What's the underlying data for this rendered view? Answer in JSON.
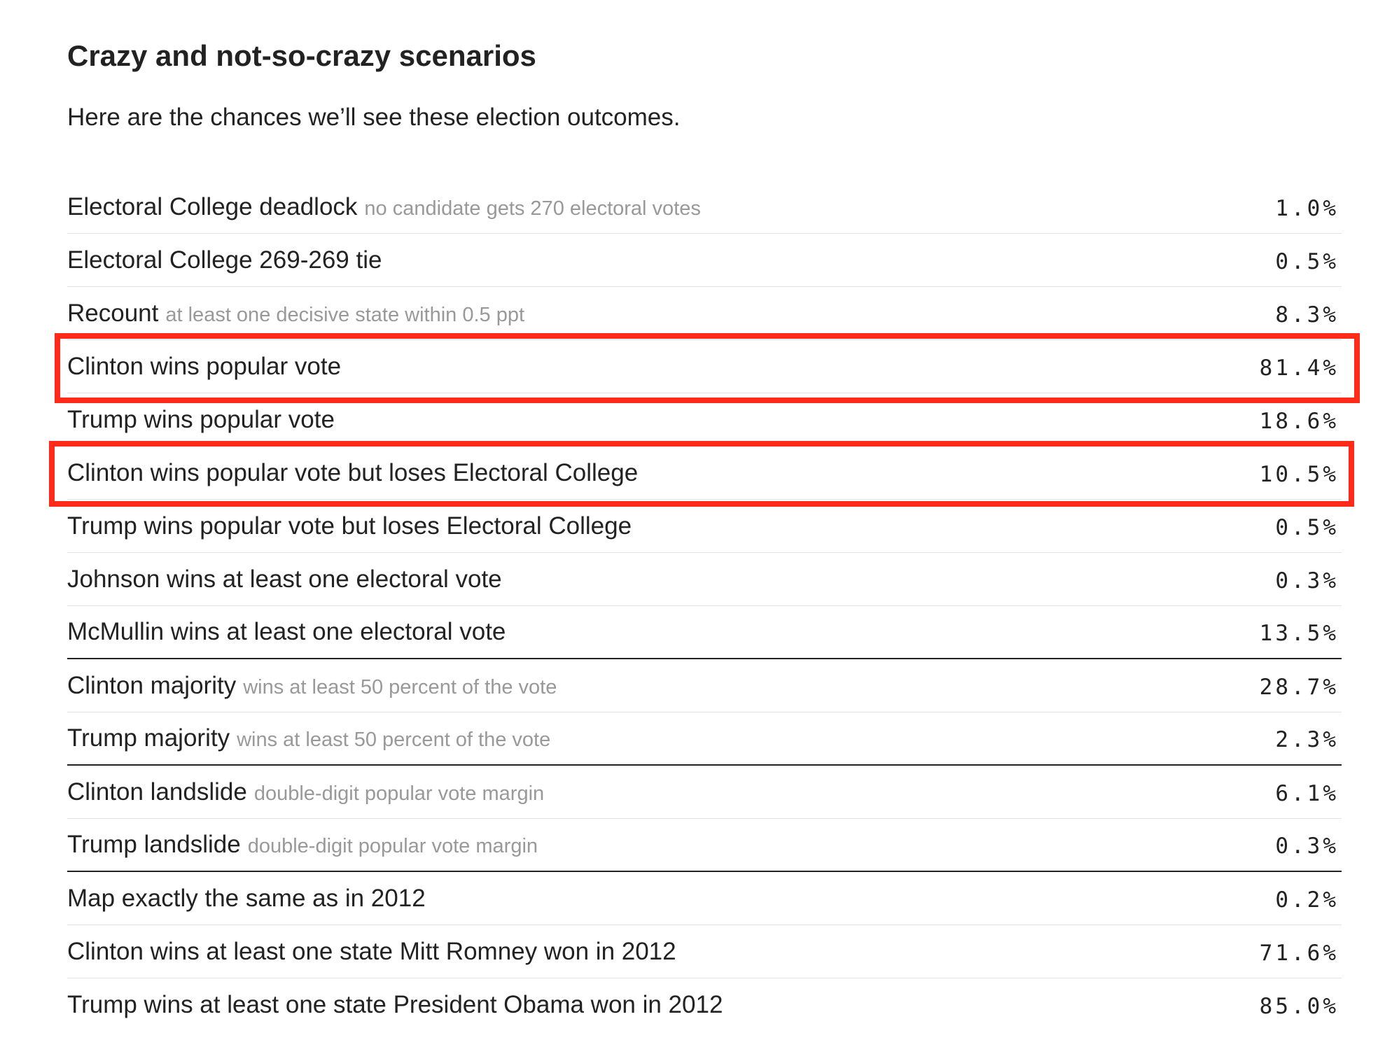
{
  "title": "Crazy and not-so-crazy scenarios",
  "subtitle": "Here are the chances we’ll see these election outcomes.",
  "rows": [
    {
      "label": "Electoral College deadlock",
      "note": "no candidate gets 270 electoral votes",
      "value": "1.0%"
    },
    {
      "label": "Electoral College 269-269 tie",
      "note": "",
      "value": "0.5%"
    },
    {
      "label": "Recount",
      "note": "at least one decisive state within 0.5 ppt",
      "value": "8.3%"
    },
    {
      "label": "Clinton wins popular vote",
      "note": "",
      "value": "81.4%"
    },
    {
      "label": "Trump wins popular vote",
      "note": "",
      "value": "18.6%"
    },
    {
      "label": "Clinton wins popular vote but loses Electoral College",
      "note": "",
      "value": "10.5%"
    },
    {
      "label": "Trump wins popular vote but loses Electoral College",
      "note": "",
      "value": "0.5%"
    },
    {
      "label": "Johnson wins at least one electoral vote",
      "note": "",
      "value": "0.3%"
    },
    {
      "label": "McMullin wins at least one electoral vote",
      "note": "",
      "value": "13.5%"
    },
    {
      "label": "Clinton majority",
      "note": "wins at least 50 percent of the vote",
      "value": "28.7%"
    },
    {
      "label": "Trump majority",
      "note": "wins at least 50 percent of the vote",
      "value": "2.3%"
    },
    {
      "label": "Clinton landslide",
      "note": "double-digit popular vote margin",
      "value": "6.1%"
    },
    {
      "label": "Trump landslide",
      "note": "double-digit popular vote margin",
      "value": "0.3%"
    },
    {
      "label": "Map exactly the same as in 2012",
      "note": "",
      "value": "0.2%"
    },
    {
      "label": "Clinton wins at least one state Mitt Romney won in 2012",
      "note": "",
      "value": "71.6%"
    },
    {
      "label": "Trump wins at least one state President Obama won in 2012",
      "note": "",
      "value": "85.0%"
    }
  ],
  "highlight_color": "#ff2a1a"
}
